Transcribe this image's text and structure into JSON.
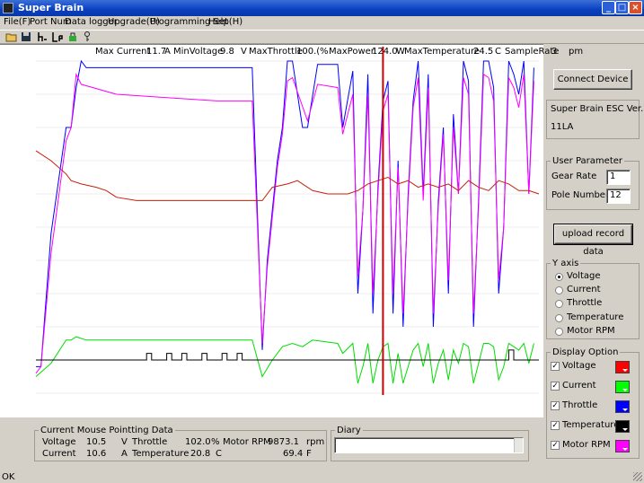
{
  "window": {
    "title": "Super Brain"
  },
  "menu": [
    "File(F)",
    "Port Num",
    "Data logger",
    "Upgrade(U)",
    "Programming Set",
    "Help(H)"
  ],
  "toolbar_icons": [
    "folder-open-icon",
    "save-icon",
    "rpm-icon",
    "current-icon",
    "lock-icon",
    "key-icon"
  ],
  "header": {
    "max_current_label": "Max Current",
    "max_current": "11.7",
    "current_unit": "A",
    "min_voltage_label": "MinVoltage",
    "min_voltage": "9.8",
    "voltage_unit": "V",
    "max_throttle_label": "MaxThrottle",
    "max_throttle": "100.(",
    "throttle_unit": "%",
    "max_power_label": "MaxPower",
    "max_power": "124.0",
    "power_unit": "W",
    "max_temp_label": "MaxTemperature",
    "max_temp": "24.5",
    "temp_unit": "C",
    "sample_rate_label": "SampleRate",
    "sample_rate": "3",
    "sample_unit": "pm"
  },
  "right_panel": {
    "connect_button": "Connect Device",
    "esc_ver_label": "Super Brain ESC Ver.",
    "esc_ver_value": "11LA",
    "user_param_title": "User Parameter",
    "gear_rate_label": "Gear Rate",
    "gear_rate_value": "1",
    "pole_number_label": "Pole Number",
    "pole_number_value": "12",
    "upload_button": "upload record data",
    "y_axis_title": "Y axis",
    "y_axis_options": [
      "Voltage",
      "Current",
      "Throttle",
      "Temperature",
      "Motor RPM"
    ],
    "y_axis_selected": "Voltage",
    "display_title": "Display Option",
    "display_options": [
      {
        "label": "Voltage",
        "color": "#ff0000",
        "checked": true
      },
      {
        "label": "Current",
        "color": "#00ff00",
        "checked": true
      },
      {
        "label": "Throttle",
        "color": "#0000ff",
        "checked": true
      },
      {
        "label": "Temperature",
        "color": "#000000",
        "checked": true
      },
      {
        "label": "Motor RPM",
        "color": "#ff00ff",
        "checked": true
      }
    ]
  },
  "mouse_data": {
    "title": "Current Mouse Pointting Data",
    "voltage_label": "Voltage",
    "voltage_value": "10.5",
    "voltage_unit": "V",
    "throttle_label": "Throttle",
    "throttle_value": "102.0",
    "throttle_unit": "%",
    "rpm_label": "Motor RPM",
    "rpm_value": "9873.1",
    "rpm_unit": "rpm",
    "current_label": "Current",
    "current_value": "10.6",
    "current_unit": "A",
    "temp_label": "Temperature",
    "temp_value_c": "20.8",
    "temp_unit_c": "C",
    "temp_value_f": "69.4",
    "temp_unit_f": "F"
  },
  "diary": {
    "title": "Diary",
    "value": ""
  },
  "status": "OK",
  "chart_data": {
    "type": "line",
    "x_range": [
      0,
      100
    ],
    "y_range": [
      0,
      100
    ],
    "cursor_x": 69,
    "series": [
      {
        "color": "#0000ff",
        "points": [
          [
            0,
            8
          ],
          [
            1,
            8
          ],
          [
            3,
            48
          ],
          [
            6,
            80
          ],
          [
            7,
            80
          ],
          [
            8,
            92
          ],
          [
            9,
            100
          ],
          [
            10,
            98
          ],
          [
            42,
            98
          ],
          [
            43,
            98
          ],
          [
            45,
            13
          ],
          [
            46,
            40
          ],
          [
            48,
            70
          ],
          [
            49,
            80
          ],
          [
            50,
            100
          ],
          [
            51,
            100
          ],
          [
            53,
            80
          ],
          [
            54,
            80
          ],
          [
            56,
            99
          ],
          [
            60,
            99
          ],
          [
            61,
            80
          ],
          [
            63,
            97
          ],
          [
            64,
            30
          ],
          [
            65,
            55
          ],
          [
            66,
            96
          ],
          [
            67,
            24
          ],
          [
            68,
            62
          ],
          [
            69,
            88
          ],
          [
            70,
            94
          ],
          [
            71,
            24
          ],
          [
            72,
            70
          ],
          [
            73,
            20
          ],
          [
            74,
            60
          ],
          [
            75,
            88
          ],
          [
            76,
            100
          ],
          [
            77,
            60
          ],
          [
            78,
            96
          ],
          [
            79,
            20
          ],
          [
            80,
            58
          ],
          [
            81,
            80
          ],
          [
            82,
            30
          ],
          [
            83,
            84
          ],
          [
            84,
            60
          ],
          [
            85,
            100
          ],
          [
            86,
            94
          ],
          [
            87,
            20
          ],
          [
            88,
            58
          ],
          [
            89,
            100
          ],
          [
            90,
            100
          ],
          [
            91,
            92
          ],
          [
            92,
            30
          ],
          [
            93,
            50
          ],
          [
            94,
            100
          ],
          [
            95,
            96
          ],
          [
            96,
            90
          ],
          [
            97,
            100
          ],
          [
            98,
            60
          ],
          [
            99,
            98
          ]
        ]
      },
      {
        "color": "#ff00ff",
        "points": [
          [
            0,
            6
          ],
          [
            1,
            8
          ],
          [
            3,
            42
          ],
          [
            6,
            76
          ],
          [
            7,
            80
          ],
          [
            8,
            96
          ],
          [
            9,
            93
          ],
          [
            16,
            90
          ],
          [
            26,
            89
          ],
          [
            36,
            88
          ],
          [
            42,
            88
          ],
          [
            43,
            88
          ],
          [
            45,
            15
          ],
          [
            46,
            38
          ],
          [
            48,
            68
          ],
          [
            49,
            78
          ],
          [
            50,
            94
          ],
          [
            51,
            95
          ],
          [
            54,
            82
          ],
          [
            56,
            93
          ],
          [
            60,
            92
          ],
          [
            61,
            78
          ],
          [
            63,
            90
          ],
          [
            64,
            35
          ],
          [
            65,
            55
          ],
          [
            66,
            90
          ],
          [
            67,
            30
          ],
          [
            68,
            60
          ],
          [
            69,
            85
          ],
          [
            70,
            90
          ],
          [
            71,
            30
          ],
          [
            72,
            68
          ],
          [
            73,
            24
          ],
          [
            74,
            58
          ],
          [
            75,
            86
          ],
          [
            76,
            95
          ],
          [
            77,
            58
          ],
          [
            78,
            92
          ],
          [
            79,
            24
          ],
          [
            80,
            56
          ],
          [
            81,
            78
          ],
          [
            82,
            34
          ],
          [
            83,
            80
          ],
          [
            84,
            60
          ],
          [
            85,
            95
          ],
          [
            86,
            90
          ],
          [
            87,
            24
          ],
          [
            88,
            56
          ],
          [
            89,
            96
          ],
          [
            90,
            95
          ],
          [
            91,
            88
          ],
          [
            92,
            34
          ],
          [
            93,
            50
          ],
          [
            94,
            95
          ],
          [
            95,
            92
          ],
          [
            96,
            86
          ],
          [
            97,
            96
          ],
          [
            98,
            60
          ],
          [
            99,
            94
          ]
        ]
      },
      {
        "color": "#c81e0a",
        "points": [
          [
            0,
            73
          ],
          [
            3,
            70
          ],
          [
            6,
            66
          ],
          [
            7,
            64
          ],
          [
            9,
            63
          ],
          [
            12,
            62
          ],
          [
            14,
            61
          ],
          [
            16,
            59
          ],
          [
            20,
            58
          ],
          [
            30,
            58
          ],
          [
            40,
            58
          ],
          [
            45,
            58
          ],
          [
            47,
            62
          ],
          [
            50,
            63
          ],
          [
            52,
            64
          ],
          [
            55,
            61
          ],
          [
            58,
            60
          ],
          [
            62,
            60
          ],
          [
            64,
            61
          ],
          [
            66,
            63
          ],
          [
            68,
            64
          ],
          [
            70,
            65
          ],
          [
            72,
            63
          ],
          [
            74,
            64
          ],
          [
            76,
            62
          ],
          [
            78,
            63
          ],
          [
            80,
            62
          ],
          [
            82,
            63
          ],
          [
            84,
            61
          ],
          [
            86,
            64
          ],
          [
            88,
            62
          ],
          [
            90,
            61
          ],
          [
            92,
            64
          ],
          [
            94,
            63
          ],
          [
            96,
            61
          ],
          [
            98,
            61
          ],
          [
            100,
            60
          ]
        ]
      },
      {
        "color": "#00dd00",
        "points": [
          [
            0,
            5
          ],
          [
            3,
            9
          ],
          [
            6,
            16
          ],
          [
            7,
            16
          ],
          [
            8,
            17
          ],
          [
            10,
            16
          ],
          [
            20,
            16
          ],
          [
            30,
            16
          ],
          [
            40,
            16
          ],
          [
            42,
            16
          ],
          [
            43,
            16
          ],
          [
            45,
            5
          ],
          [
            47,
            10
          ],
          [
            49,
            14
          ],
          [
            51,
            15
          ],
          [
            53,
            14
          ],
          [
            55,
            16
          ],
          [
            60,
            15
          ],
          [
            61,
            12
          ],
          [
            63,
            15
          ],
          [
            64,
            3
          ],
          [
            65,
            8
          ],
          [
            66,
            15
          ],
          [
            67,
            3
          ],
          [
            68,
            10
          ],
          [
            69,
            14
          ],
          [
            70,
            15
          ],
          [
            71,
            3
          ],
          [
            72,
            12
          ],
          [
            73,
            3
          ],
          [
            74,
            8
          ],
          [
            75,
            13
          ],
          [
            76,
            15
          ],
          [
            77,
            8
          ],
          [
            78,
            15
          ],
          [
            79,
            3
          ],
          [
            80,
            9
          ],
          [
            81,
            13
          ],
          [
            82,
            4
          ],
          [
            83,
            13
          ],
          [
            84,
            9
          ],
          [
            85,
            15
          ],
          [
            86,
            14
          ],
          [
            87,
            3
          ],
          [
            88,
            9
          ],
          [
            89,
            15
          ],
          [
            90,
            15
          ],
          [
            91,
            14
          ],
          [
            92,
            4
          ],
          [
            93,
            8
          ],
          [
            94,
            15
          ],
          [
            95,
            14
          ],
          [
            96,
            13
          ],
          [
            97,
            15
          ],
          [
            98,
            9
          ],
          [
            99,
            15
          ]
        ]
      },
      {
        "color": "#000000",
        "points": [
          [
            0,
            10
          ],
          [
            20,
            10
          ],
          [
            22,
            10
          ],
          [
            22,
            12
          ],
          [
            23,
            12
          ],
          [
            23,
            10
          ],
          [
            26,
            10
          ],
          [
            26,
            12
          ],
          [
            27,
            12
          ],
          [
            27,
            10
          ],
          [
            29,
            10
          ],
          [
            29,
            12
          ],
          [
            30,
            12
          ],
          [
            30,
            10
          ],
          [
            33,
            10
          ],
          [
            33,
            12
          ],
          [
            34,
            12
          ],
          [
            34,
            10
          ],
          [
            37,
            10
          ],
          [
            37,
            12
          ],
          [
            38,
            12
          ],
          [
            38,
            10
          ],
          [
            40,
            10
          ],
          [
            40,
            12
          ],
          [
            41,
            12
          ],
          [
            41,
            10
          ],
          [
            45,
            10
          ],
          [
            60,
            10
          ],
          [
            80,
            10
          ],
          [
            90,
            10
          ],
          [
            94,
            10
          ],
          [
            94,
            13
          ],
          [
            95,
            13
          ],
          [
            95,
            10
          ],
          [
            100,
            10
          ]
        ]
      }
    ]
  }
}
